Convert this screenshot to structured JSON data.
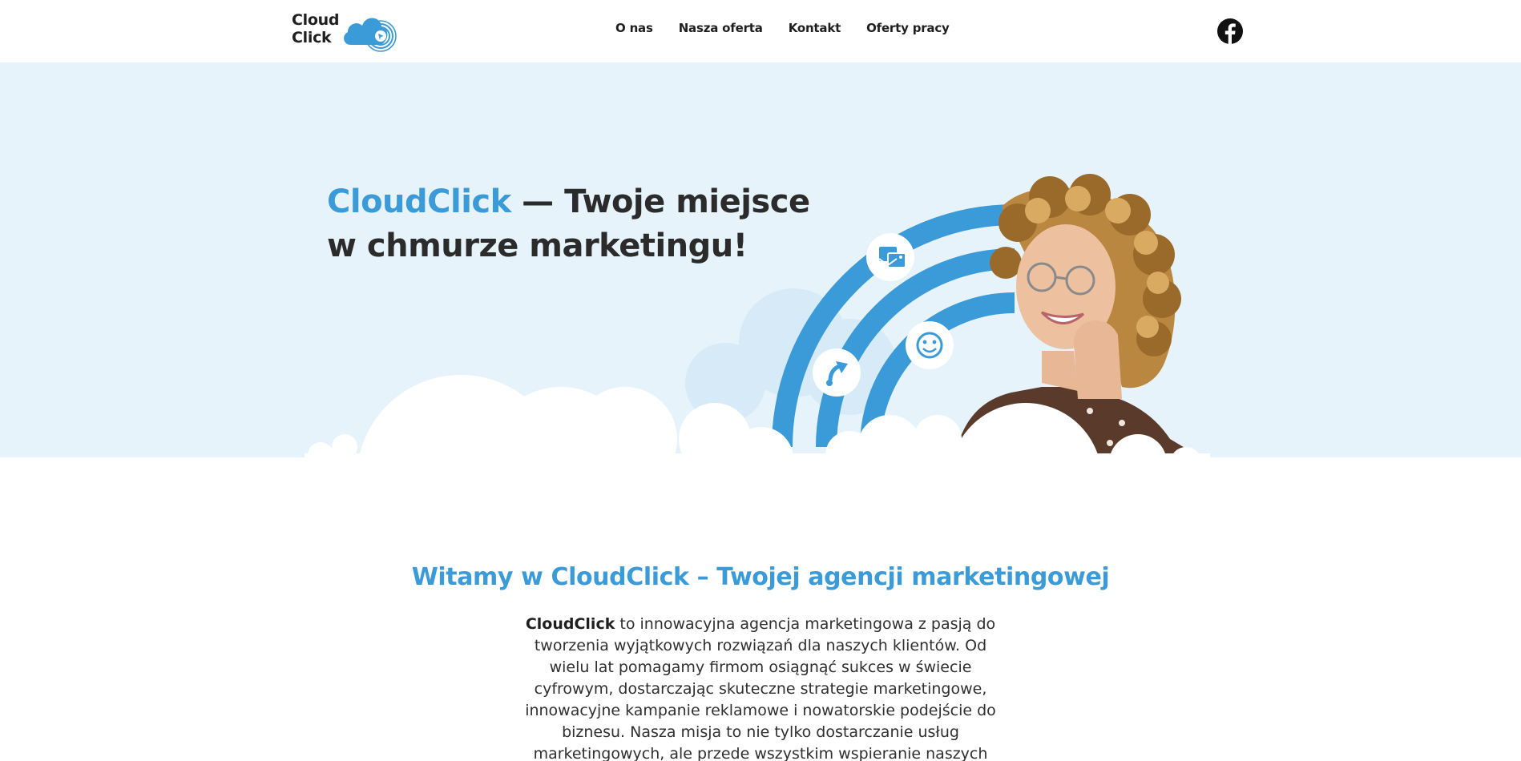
{
  "logo": {
    "line1": "Cloud",
    "line2": "Click"
  },
  "nav": [
    "O nas",
    "Nasza oferta",
    "Kontakt",
    "Oferty pracy"
  ],
  "icons": {
    "social": "facebook-icon",
    "hero_badges": [
      "mail-image-icon",
      "smiley-icon",
      "cursor-arrow-icon"
    ]
  },
  "colors": {
    "accent": "#3a9bd8",
    "hero_bg": "#e6f3fb",
    "text": "#2b2b2b"
  },
  "hero": {
    "brand": "CloudClick",
    "title_rest": " — Twoje miejsce w chmurze marketingu!"
  },
  "intro": {
    "title": "Witamy w CloudClick – Twojej agencji marketingowej",
    "brand": "CloudClick",
    "body": " to innowacyjna agencja marketingowa z pasją do tworzenia wyjątkowych rozwiązań dla naszych klientów. Od wielu lat pomagamy firmom osiągnąć sukces w świecie cyfrowym, dostarczając skuteczne strategie marketingowe, innowacyjne kampanie reklamowe i nowatorskie podejście do biznesu. Nasza misja to nie tylko dostarczanie usług marketingowych, ale przede wszystkim wspieranie naszych"
  }
}
